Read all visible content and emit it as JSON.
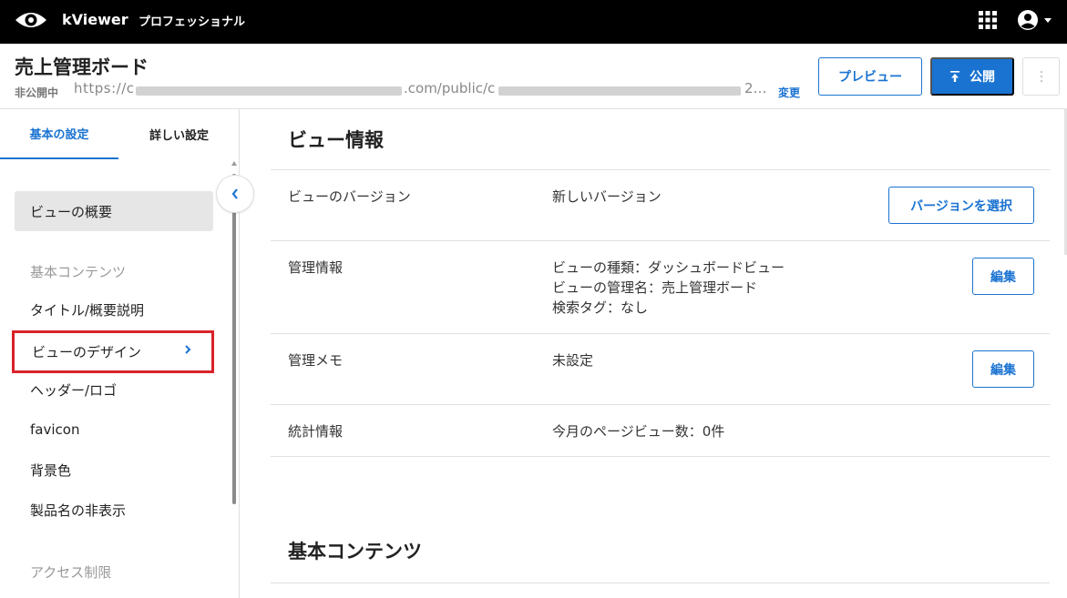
{
  "topbar": {
    "app_name": "kViewer",
    "edition": "プロフェッショナル",
    "icons": [
      "eye-logo-icon",
      "apps-grid-icon",
      "account-circle-icon",
      "caret-down-icon"
    ]
  },
  "header": {
    "title": "売上管理ボード",
    "status": "非公開中",
    "url_prefix": "https://c",
    "url_middle": ".com/public/c",
    "url_suffix": "2…",
    "change_label": "変更",
    "preview_label": "プレビュー",
    "publish_label": "公開"
  },
  "sidebar": {
    "tabs": [
      "基本の設定",
      "詳しい設定"
    ],
    "items": [
      {
        "label": "ビューの概要"
      },
      {
        "label": "基本コンテンツ"
      },
      {
        "label": "タイトル/概要説明"
      },
      {
        "label": "ビューのデザイン"
      },
      {
        "label": "ヘッダー/ロゴ"
      },
      {
        "label": "favicon"
      },
      {
        "label": "背景色"
      },
      {
        "label": "製品名の非表示"
      },
      {
        "label": "アクセス制限"
      }
    ]
  },
  "main": {
    "section_title": "ビュー情報",
    "rows": [
      {
        "label": "ビューのバージョン",
        "values": [
          "新しいバージョン"
        ],
        "button": "バージョンを選択"
      },
      {
        "label": "管理情報",
        "values": [
          "ビューの種類：ダッシュボードビュー",
          "ビューの管理名：売上管理ボード",
          "検索タグ：なし"
        ],
        "button": "編集"
      },
      {
        "label": "管理メモ",
        "values": [
          "未設定"
        ],
        "button": "編集"
      },
      {
        "label": "統計情報",
        "values": [
          "今月のページビュー数：0件"
        ]
      }
    ],
    "section2_title": "基本コンテンツ"
  },
  "colors": {
    "accent": "#1a73d1",
    "topbar_bg": "#000000",
    "highlight": "#d9232a"
  }
}
